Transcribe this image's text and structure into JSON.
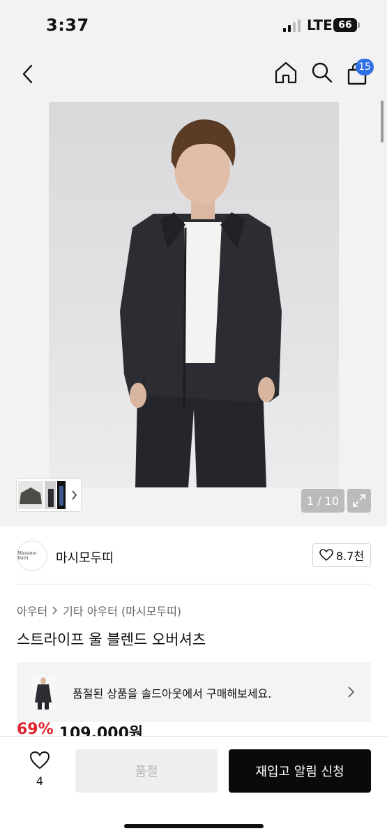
{
  "status_bar": {
    "time": "3:37",
    "network": "LTE",
    "battery": "66"
  },
  "header": {
    "cart_count": "15"
  },
  "gallery": {
    "counter": "1 / 10"
  },
  "brand": {
    "logo_text": "Massimo Dutti",
    "name": "마시모두띠",
    "likes": "8.7천"
  },
  "breadcrumb": {
    "category": "아우터",
    "subcategory": "기타 아우터 (마시모두띠)"
  },
  "product": {
    "title": "스트라이프 울 블렌드 오버셔츠",
    "discount": "69%",
    "price": "109,000원"
  },
  "soldout_banner": {
    "text": "품절된 상품을 솔드아웃에서 구매해보세요."
  },
  "bottom_bar": {
    "wish_count": "4",
    "soldout_label": "품절",
    "restock_label": "재입고 알림 신청"
  },
  "colors": {
    "accent": "#2f6fe4",
    "discount": "#e0242c",
    "primary_button": "#0a0a0a"
  }
}
